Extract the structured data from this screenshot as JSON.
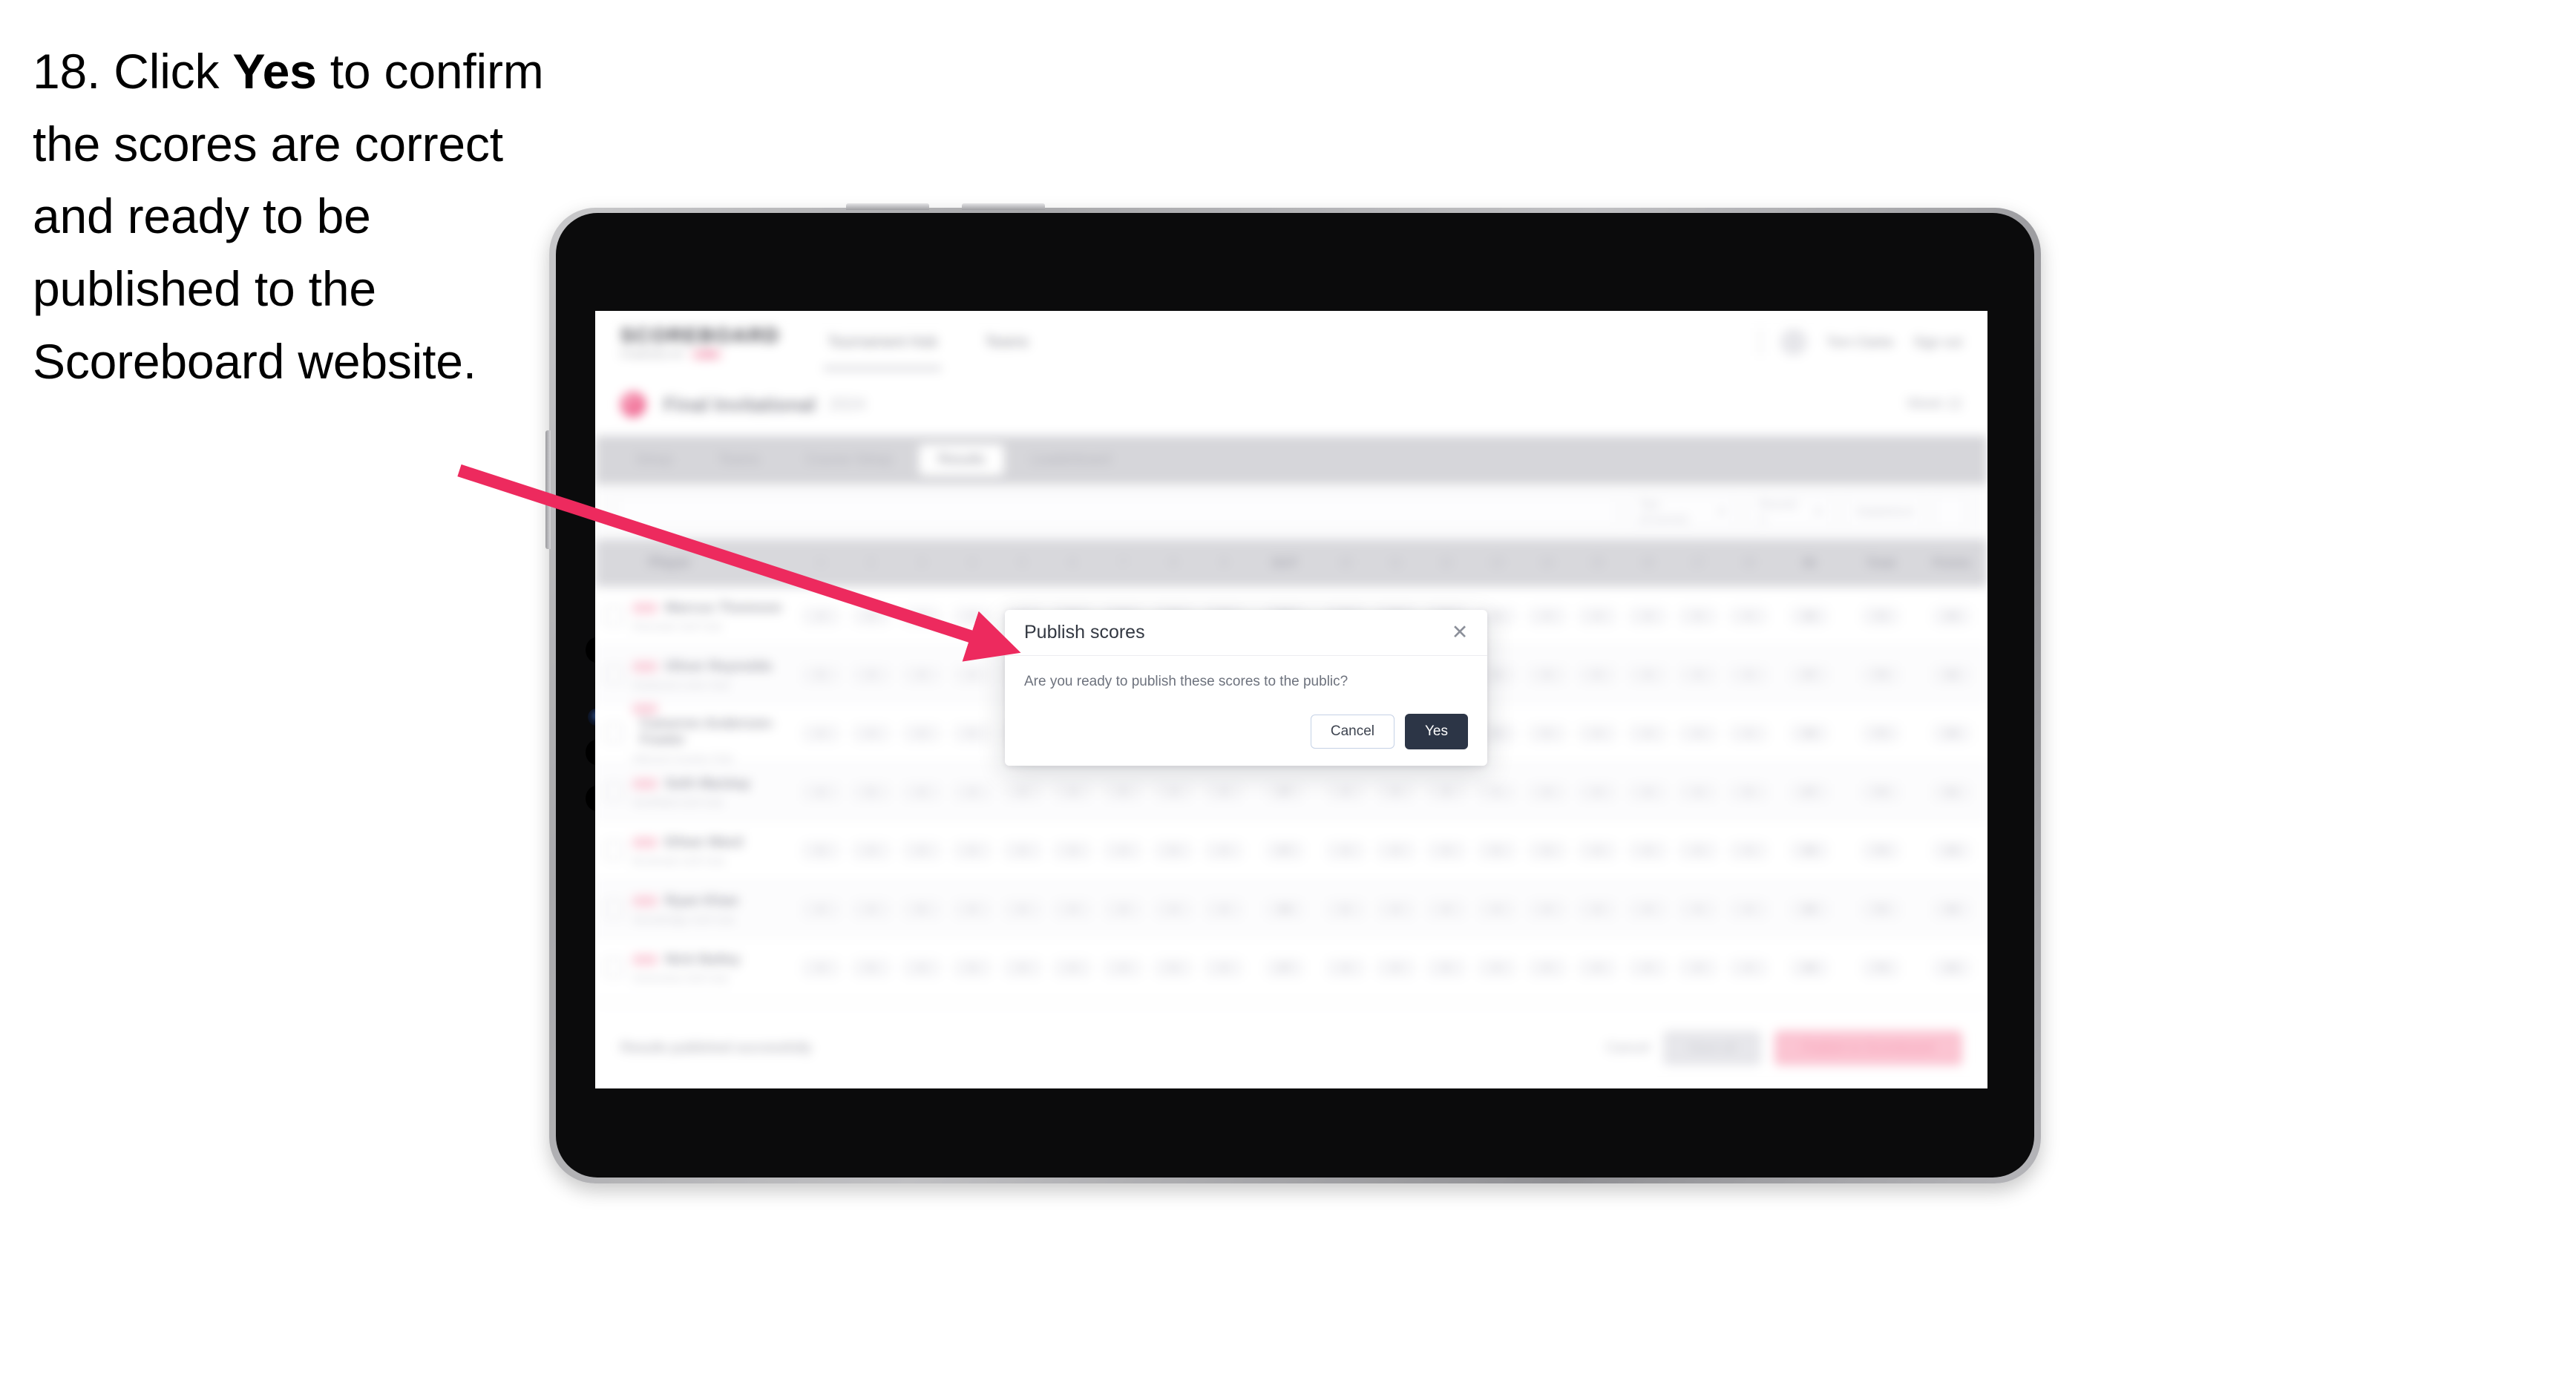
{
  "instruction": {
    "number": "18.",
    "lead": "Click",
    "emphasis": "Yes",
    "rest": "to confirm the scores are correct and ready to be published to the Scoreboard website."
  },
  "colors": {
    "arrow": "#ED2A5E",
    "primary_button": "#2C3546",
    "brand_accent": "#E8467A",
    "bezel": "#B3B3B7",
    "frame": "#0B0B0C"
  },
  "app": {
    "header": {
      "brand_word": "SCOREBOARD",
      "brand_sub": "POWERED BY",
      "brand_pill": "LIVE",
      "nav": [
        {
          "label": "Tournament Hub",
          "active": true
        },
        {
          "label": "Teams",
          "active": false
        }
      ],
      "user_name": "Tom Clarke",
      "sign_out": "Sign out"
    },
    "title_bar": {
      "title": "Final Invitational",
      "meta": "2024",
      "right": "Week 12"
    },
    "tabs": [
      {
        "label": "Setup",
        "selected": false
      },
      {
        "label": "Teams",
        "selected": false
      },
      {
        "label": "Course Setup",
        "selected": false
      },
      {
        "label": "Results",
        "selected": true
      },
      {
        "label": "Leaderboard",
        "selected": false
      }
    ],
    "filters": {
      "search_placeholder": "Search",
      "tee_select": "Tee (Course)",
      "round_select": "Round 1",
      "state_select": "Stableford"
    },
    "table": {
      "columns": [
        "Player",
        "1",
        "2",
        "3",
        "4",
        "5",
        "6",
        "7",
        "8",
        "9",
        "OUT",
        "10",
        "11",
        "12",
        "13",
        "14",
        "15",
        "16",
        "17",
        "18",
        "IN",
        "Total",
        "Points"
      ],
      "rows": [
        {
          "badge": "AM",
          "name": "Marcus Thomson",
          "sub": "Riverside Golf Club",
          "scores": [
            "4",
            "5",
            "3",
            "4",
            "4",
            "5",
            "3",
            "4",
            "4",
            "36",
            "4",
            "3",
            "5",
            "4",
            "4",
            "4",
            "3",
            "5",
            "4",
            "36",
            "72",
            "34"
          ]
        },
        {
          "badge": "AM",
          "name": "Oliver Reynolds",
          "sub": "Eastwood Links Club",
          "scores": [
            "5",
            "4",
            "4",
            "3",
            "5",
            "4",
            "4",
            "4",
            "3",
            "36",
            "5",
            "4",
            "4",
            "4",
            "3",
            "5",
            "4",
            "4",
            "4",
            "37",
            "73",
            "32"
          ]
        },
        {
          "badge": "PR",
          "name": "Cameron Anderson-Fowler",
          "sub": "Hillcrest Country Club",
          "scores": [
            "4",
            "4",
            "3",
            "5",
            "4",
            "4",
            "4",
            "4",
            "4",
            "36",
            "4",
            "4",
            "4",
            "3",
            "5",
            "4",
            "4",
            "4",
            "4",
            "36",
            "72",
            "35"
          ]
        },
        {
          "badge": "AM",
          "name": "Seth Mackay",
          "sub": "Northfield Golf Club",
          "scores": [
            "4",
            "5",
            "4",
            "4",
            "3",
            "4",
            "5",
            "4",
            "4",
            "37",
            "4",
            "5",
            "3",
            "4",
            "4",
            "4",
            "4",
            "4",
            "5",
            "37",
            "74",
            "31"
          ]
        },
        {
          "badge": "AM",
          "name": "Ethan Ward",
          "sub": "Brookvale Golf Club",
          "scores": [
            "5",
            "4",
            "4",
            "4",
            "4",
            "3",
            "4",
            "5",
            "4",
            "37",
            "4",
            "4",
            "4",
            "5",
            "3",
            "4",
            "4",
            "4",
            "4",
            "36",
            "73",
            "33"
          ]
        },
        {
          "badge": "PR",
          "name": "Ryan Khan",
          "sub": "Stonebridge Golf Club",
          "scores": [
            "4",
            "4",
            "5",
            "4",
            "4",
            "4",
            "3",
            "4",
            "4",
            "36",
            "5",
            "4",
            "4",
            "4",
            "4",
            "3",
            "4",
            "4",
            "4",
            "36",
            "72",
            "34"
          ]
        },
        {
          "badge": "AM",
          "name": "Nick Bailey",
          "sub": "Greenview Golf Club",
          "scores": [
            "4",
            "5",
            "4",
            "3",
            "4",
            "4",
            "4",
            "5",
            "4",
            "37",
            "4",
            "4",
            "5",
            "4",
            "4",
            "4",
            "4",
            "3",
            "4",
            "36",
            "73",
            "32"
          ]
        }
      ]
    },
    "action_bar": {
      "note": "Results published successfully",
      "cancel": "Cancel",
      "save": "Save all",
      "publish": "Publish to Scoreboard"
    }
  },
  "modal": {
    "title": "Publish scores",
    "message": "Are you ready to publish these scores to the public?",
    "close_icon": "✕",
    "cancel_label": "Cancel",
    "confirm_label": "Yes"
  }
}
